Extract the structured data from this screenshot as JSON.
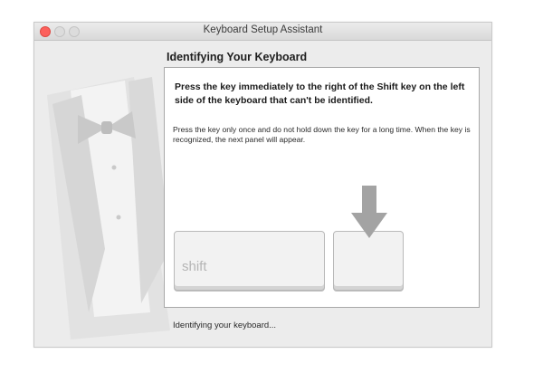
{
  "window": {
    "title": "Keyboard Setup Assistant"
  },
  "heading": "Identifying Your Keyboard",
  "instruction_bold": "Press the key immediately to the right of the Shift key on the left side of the keyboard that can't be identified.",
  "instruction_detail": "Press the key only once and do not hold down the key for a long time. When the key is recognized, the next panel will appear.",
  "keys": {
    "shift_label": "shift"
  },
  "status": "Identifying your keyboard...",
  "icons": {
    "arrow": "down-arrow-icon",
    "background": "tuxedo-bowtie-icon"
  },
  "colors": {
    "close": "#fc605c",
    "panel_bg": "#ffffff",
    "window_bg": "#ececec"
  }
}
